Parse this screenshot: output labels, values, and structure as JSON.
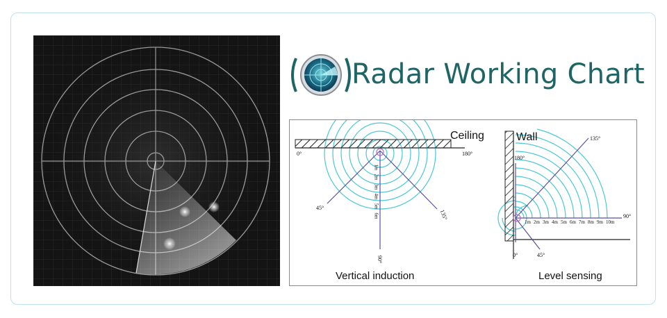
{
  "title": {
    "text": "Radar Working Chart"
  },
  "diagram_left": {
    "surface_label": "Ceiling",
    "caption": "Vertical induction",
    "angle_left": "0°",
    "angle_right": "180°",
    "angle_45": "45°",
    "angle_135": "135°",
    "angle_90": "90°",
    "distances": [
      "1m",
      "2m",
      "3m",
      "4m",
      "5m",
      "6m"
    ]
  },
  "diagram_right": {
    "surface_label": "Wall",
    "caption": "Level sensing",
    "angle_top": "180°",
    "angle_135": "135°",
    "angle_90": "90°",
    "angle_45": "45°",
    "angle_0": "0°",
    "distances": [
      "1m",
      "2m",
      "3m",
      "4m",
      "5m",
      "6m",
      "7m",
      "8m",
      "9m",
      "10m"
    ]
  },
  "colors": {
    "title": "#1f6566",
    "wave": "#49c8d2",
    "radar_bg": "#141414",
    "frame_border": "#bfe2ea"
  }
}
